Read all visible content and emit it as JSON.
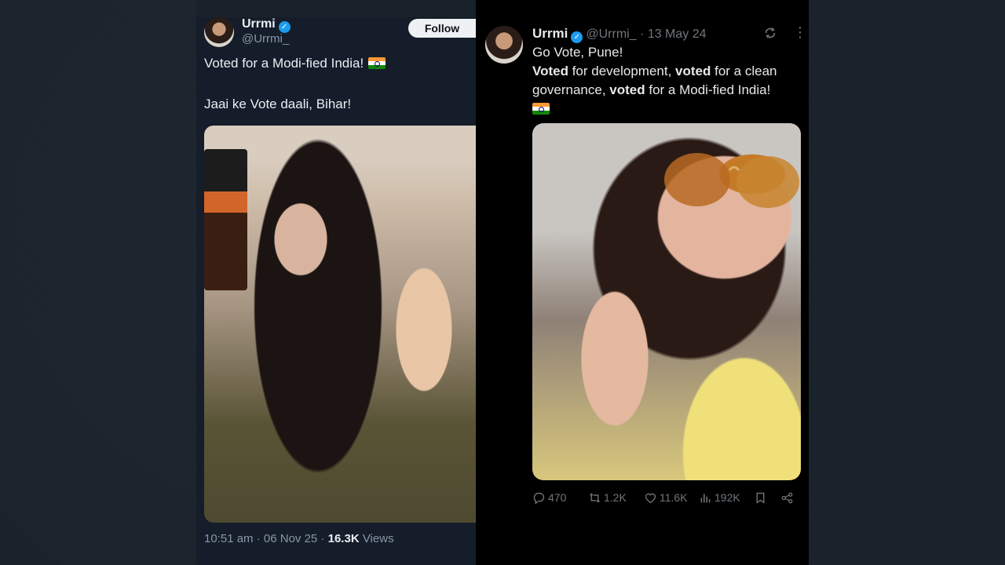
{
  "left_tweet": {
    "name": "Urrmi",
    "handle": "@Urrmi_",
    "follow_label": "Follow",
    "line1": "Voted for a Modi-fied India!",
    "line2": "Jaai ke Vote daali, Bihar!",
    "time": "10:51 am",
    "date": "06 Nov 25",
    "views_count": "16.3K",
    "views_label": "Views"
  },
  "right_tweet": {
    "name": "Urrmi",
    "handle": "@Urrmi_",
    "date": "13 May 24",
    "line1": "Go Vote, Pune!",
    "line2_parts": [
      {
        "text": "Voted",
        "bold": true
      },
      {
        "text": " for development, ",
        "bold": false
      },
      {
        "text": "voted",
        "bold": true
      },
      {
        "text": " for a clean governance, ",
        "bold": false
      },
      {
        "text": "voted",
        "bold": true
      },
      {
        "text": " for a Modi-fied India!",
        "bold": false
      }
    ],
    "replies": "470",
    "reposts": "1.2K",
    "likes": "11.6K",
    "views": "192K"
  },
  "colors": {
    "background": "#19212b",
    "left_card": "#141d29",
    "right_card": "#000000",
    "verified": "#1d9bf0"
  },
  "icons": [
    "verified-badge",
    "india-flag",
    "grok-icon",
    "more-icon",
    "reply-icon",
    "repost-icon",
    "like-icon",
    "views-icon",
    "bookmark-icon",
    "share-icon"
  ]
}
